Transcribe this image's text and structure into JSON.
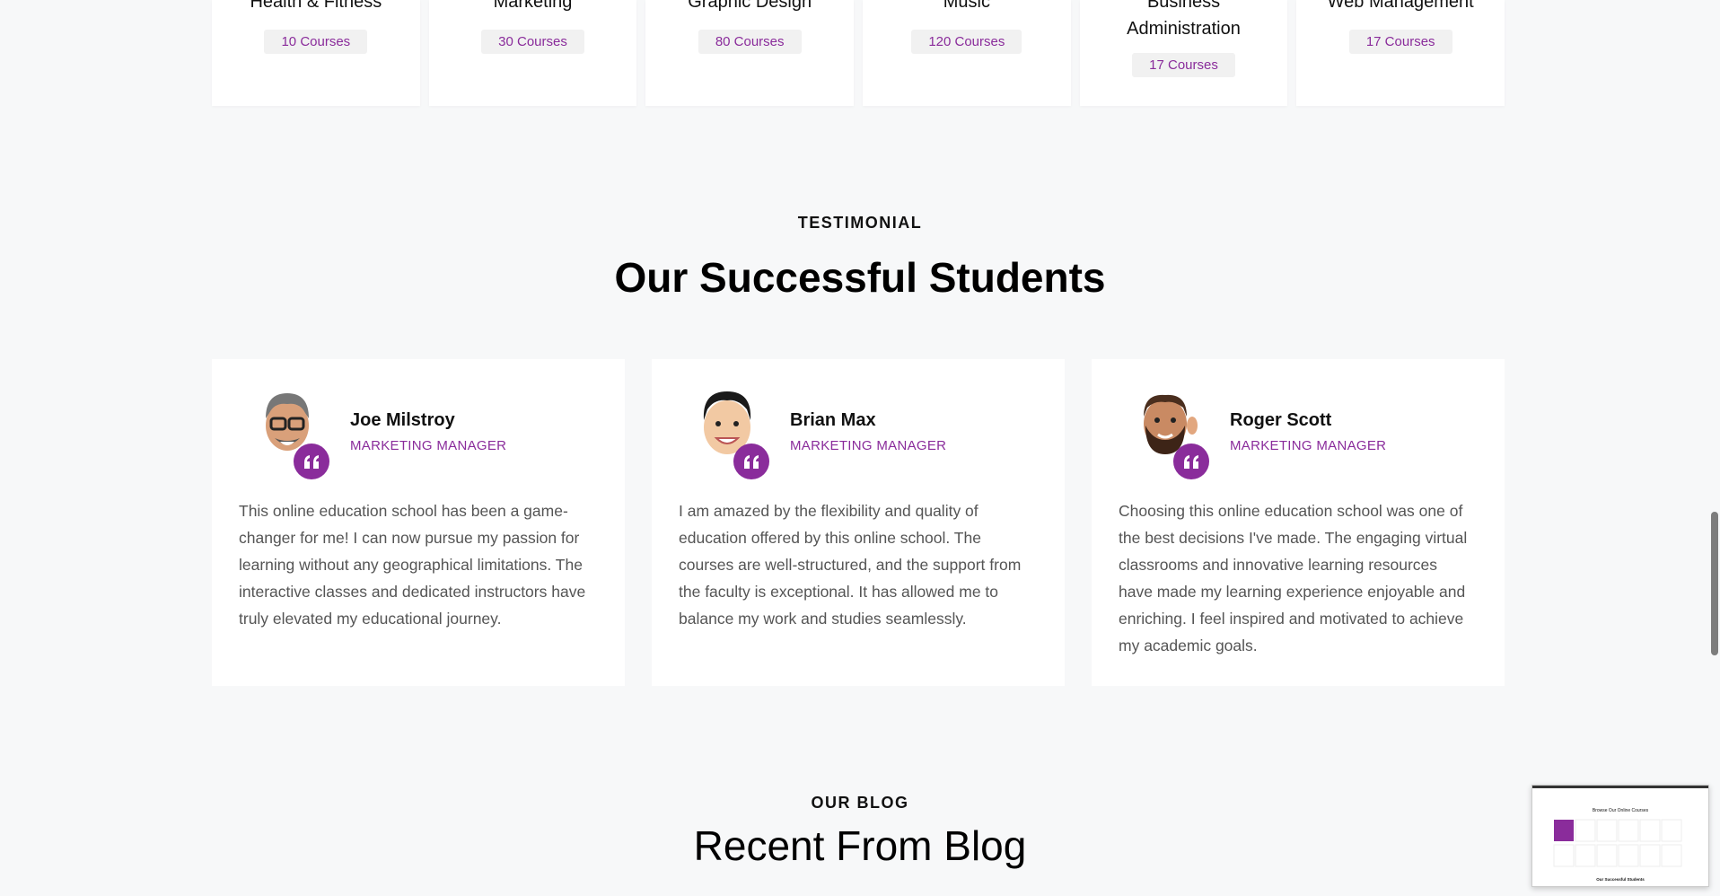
{
  "categories": [
    {
      "name": "Health & Fitness",
      "count": "10 Courses"
    },
    {
      "name": "Marketing",
      "count": "30 Courses"
    },
    {
      "name": "Graphic Design",
      "count": "80 Courses"
    },
    {
      "name": "Music",
      "count": "120 Courses"
    },
    {
      "name": "Business Administration",
      "count": "17 Courses"
    },
    {
      "name": "Web Management",
      "count": "17 Courses"
    }
  ],
  "testimonial": {
    "eyebrow": "TESTIMONIAL",
    "title": "Our Successful Students",
    "cards": [
      {
        "name": "Joe Milstroy",
        "role": "MARKETING MANAGER",
        "text": "This online education school has been a game-changer for me! I can now pursue my passion for learning without any geographical limitations. The interactive classes and dedicated instructors have truly elevated my educational journey."
      },
      {
        "name": "Brian Max",
        "role": "MARKETING MANAGER",
        "text": "I am amazed by the flexibility and quality of education offered by this online school. The courses are well-structured, and the support from the faculty is exceptional. It has allowed me to balance my work and studies seamlessly."
      },
      {
        "name": "Roger Scott",
        "role": "MARKETING MANAGER",
        "text": "Choosing this online education school was one of the best decisions I've made. The engaging virtual classrooms and innovative learning resources have made my learning experience enjoyable and enriching. I feel inspired and motivated to achieve my academic goals."
      }
    ]
  },
  "blog": {
    "eyebrow": "OUR BLOG",
    "title": "Recent From Blog"
  },
  "minimap": {
    "heading": "Browse Our Online Courses",
    "footer": "Our Successful Students"
  },
  "colors": {
    "accent": "#8a2c9b",
    "background": "#f7f8f9",
    "card": "#ffffff"
  }
}
